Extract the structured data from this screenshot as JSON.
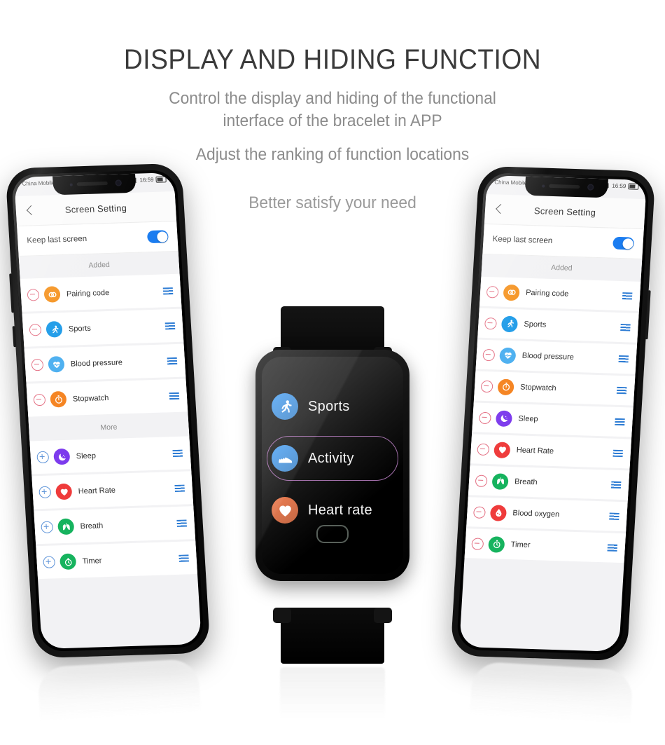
{
  "hero": {
    "title": "DISPLAY AND HIDING FUNCTION",
    "subtitle_line1": "Control the display and hiding of the functional",
    "subtitle_line2": "interface of the bracelet in APP",
    "subtitle_line3": "Adjust the ranking of function locations",
    "subtitle_line4": "Better satisfy your need"
  },
  "colors": {
    "accent_blue": "#1a7cf0",
    "remove_red": "#e36b7f",
    "add_blue": "#5b92d8",
    "drag_handle": "#2f7dd4",
    "icon_orange": "#f5921e",
    "icon_blue": "#1b9ae8",
    "icon_lightblue": "#49aef0",
    "icon_purple": "#7c3aed",
    "icon_red": "#ef3b3b",
    "icon_green": "#16b35e"
  },
  "phone_left": {
    "status_bar": {
      "carrier": "China Mobile",
      "time": "16:59"
    },
    "nav": {
      "back_label": "‹",
      "title": "Screen Setting"
    },
    "keep_last_screen": {
      "label": "Keep last screen",
      "enabled": true
    },
    "sections": [
      {
        "header": "Added",
        "mode": "remove",
        "items": [
          {
            "label": "Pairing code",
            "icon": "pairing-code-icon",
            "color": "#f5921e"
          },
          {
            "label": "Sports",
            "icon": "running-icon",
            "color": "#1b9ae8"
          },
          {
            "label": "Blood pressure",
            "icon": "blood-pressure-icon",
            "color": "#49aef0"
          },
          {
            "label": "Stopwatch",
            "icon": "stopwatch-icon",
            "color": "#f5821e"
          }
        ]
      },
      {
        "header": "More",
        "mode": "add",
        "items": [
          {
            "label": "Sleep",
            "icon": "moon-icon",
            "color": "#7c3aed"
          },
          {
            "label": "Heart Rate",
            "icon": "heart-icon",
            "color": "#ef3b3b"
          },
          {
            "label": "Breath",
            "icon": "lungs-icon",
            "color": "#16b35e"
          },
          {
            "label": "Timer",
            "icon": "timer-icon",
            "color": "#16b35e"
          }
        ]
      }
    ]
  },
  "phone_right": {
    "status_bar": {
      "carrier": "China Mobile",
      "time": "16:59"
    },
    "nav": {
      "back_label": "‹",
      "title": "Screen Setting"
    },
    "keep_last_screen": {
      "label": "Keep last screen",
      "enabled": true
    },
    "sections": [
      {
        "header": "Added",
        "mode": "remove",
        "items": [
          {
            "label": "Pairing code",
            "icon": "pairing-code-icon",
            "color": "#f5921e"
          },
          {
            "label": "Sports",
            "icon": "running-icon",
            "color": "#1b9ae8"
          },
          {
            "label": "Blood pressure",
            "icon": "blood-pressure-icon",
            "color": "#49aef0"
          },
          {
            "label": "Stopwatch",
            "icon": "stopwatch-icon",
            "color": "#f5821e"
          },
          {
            "label": "Sleep",
            "icon": "moon-icon",
            "color": "#7c3aed"
          },
          {
            "label": "Heart Rate",
            "icon": "heart-icon",
            "color": "#ef3b3b"
          },
          {
            "label": "Breath",
            "icon": "lungs-icon",
            "color": "#16b35e"
          },
          {
            "label": "Blood oxygen",
            "icon": "blood-oxygen-icon",
            "color": "#ef3b3b"
          },
          {
            "label": "Timer",
            "icon": "timer-icon",
            "color": "#16b35e"
          }
        ]
      }
    ]
  },
  "watch": {
    "menu": [
      {
        "label": "Sports",
        "icon": "running-icon",
        "color": "#5aa9f5",
        "selected": false
      },
      {
        "label": "Activity",
        "icon": "shoe-icon",
        "color": "#5aa9f5",
        "selected": true
      },
      {
        "label": "Heart rate",
        "icon": "heart-icon",
        "color": "#ef7e52",
        "selected": false
      }
    ],
    "home_indicator": "home-button"
  }
}
